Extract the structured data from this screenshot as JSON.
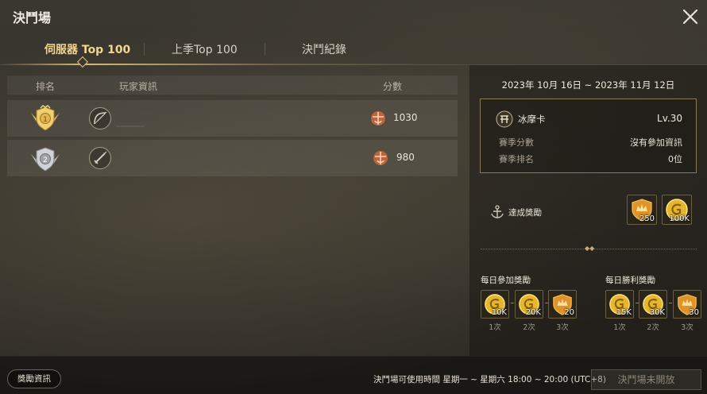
{
  "window": {
    "title": "決鬥場"
  },
  "tabs": [
    {
      "label": "伺服器 Top 100",
      "active": true
    },
    {
      "label": "上季Top 100",
      "active": false
    },
    {
      "label": "決鬥紀錄",
      "active": false
    }
  ],
  "table": {
    "headers": {
      "rank": "排名",
      "player": "玩家資訊",
      "score": "分數"
    },
    "rows": [
      {
        "rank": "1",
        "class_icon": "bow-icon",
        "score": "1030"
      },
      {
        "rank": "2",
        "class_icon": "sword-icon",
        "score": "980"
      }
    ]
  },
  "season": {
    "period": "2023年 10月 16日 ~ 2023年 11月 12日",
    "player_name": "冰摩卡",
    "level": "Lv.30",
    "score_label": "賽季分數",
    "score_value": "沒有參加資訊",
    "rank_label": "賽季排名",
    "rank_value": "0位"
  },
  "achievement": {
    "label": "達成獎勵",
    "rewards": [
      {
        "icon": "crown-shield-icon",
        "amount": "250"
      },
      {
        "icon": "gold-coin-icon",
        "amount": "100K"
      }
    ]
  },
  "daily_participation": {
    "title": "每日參加獎勵",
    "rewards": [
      {
        "icon": "gold-coin-icon",
        "amount": "10K",
        "times": "1次"
      },
      {
        "icon": "gold-coin-icon",
        "amount": "20K",
        "times": "2次"
      },
      {
        "icon": "crown-shield-icon",
        "amount": "20",
        "times": "3次"
      }
    ]
  },
  "daily_victory": {
    "title": "每日勝利獎勵",
    "rewards": [
      {
        "icon": "gold-coin-icon",
        "amount": "15K",
        "times": "1次"
      },
      {
        "icon": "gold-coin-icon",
        "amount": "30K",
        "times": "2次"
      },
      {
        "icon": "crown-shield-icon",
        "amount": "30",
        "times": "3次"
      }
    ]
  },
  "footer": {
    "reward_info": "獎勵資訊",
    "available_time": "決鬥場可使用時間 星期一 ~ 星期六 18:00 ~ 20:00 (UTC+8)",
    "status_button": "決鬥場未開放"
  },
  "colors": {
    "accent_gold": "#e8c778",
    "score_icon": "#d9865a"
  }
}
